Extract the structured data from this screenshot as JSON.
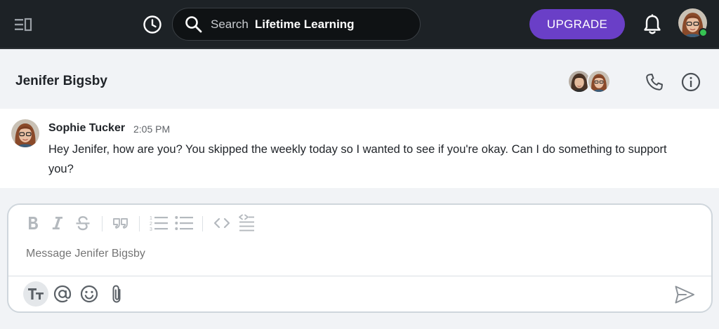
{
  "topbar": {
    "search": {
      "placeholder": "Search",
      "scope": "Lifetime Learning"
    },
    "upgrade_label": "UPGRADE",
    "presence": "online",
    "colors": {
      "background": "#1d2226",
      "upgrade": "#6a3fc7",
      "online": "#36c252"
    }
  },
  "channel": {
    "title": "Jenifer Bigsby",
    "member_avatars": [
      "avatar-1",
      "avatar-2"
    ]
  },
  "messages": [
    {
      "author": "Sophie Tucker",
      "time": "2:05 PM",
      "text": "Hey Jenifer, how are you? You skipped the weekly today so I wanted to see if you're okay. Can I do something to support you?"
    }
  ],
  "composer": {
    "placeholder": "Message Jenifer Bigsby",
    "formatting_icons": [
      "bold-icon",
      "italic-icon",
      "strikethrough-icon",
      "quote-icon",
      "numbered-list-icon",
      "bulleted-list-icon",
      "code-icon",
      "code-block-icon"
    ],
    "bottom_icons": [
      "text-format-icon",
      "mention-icon",
      "emoji-icon",
      "attachment-icon",
      "send-icon"
    ]
  }
}
